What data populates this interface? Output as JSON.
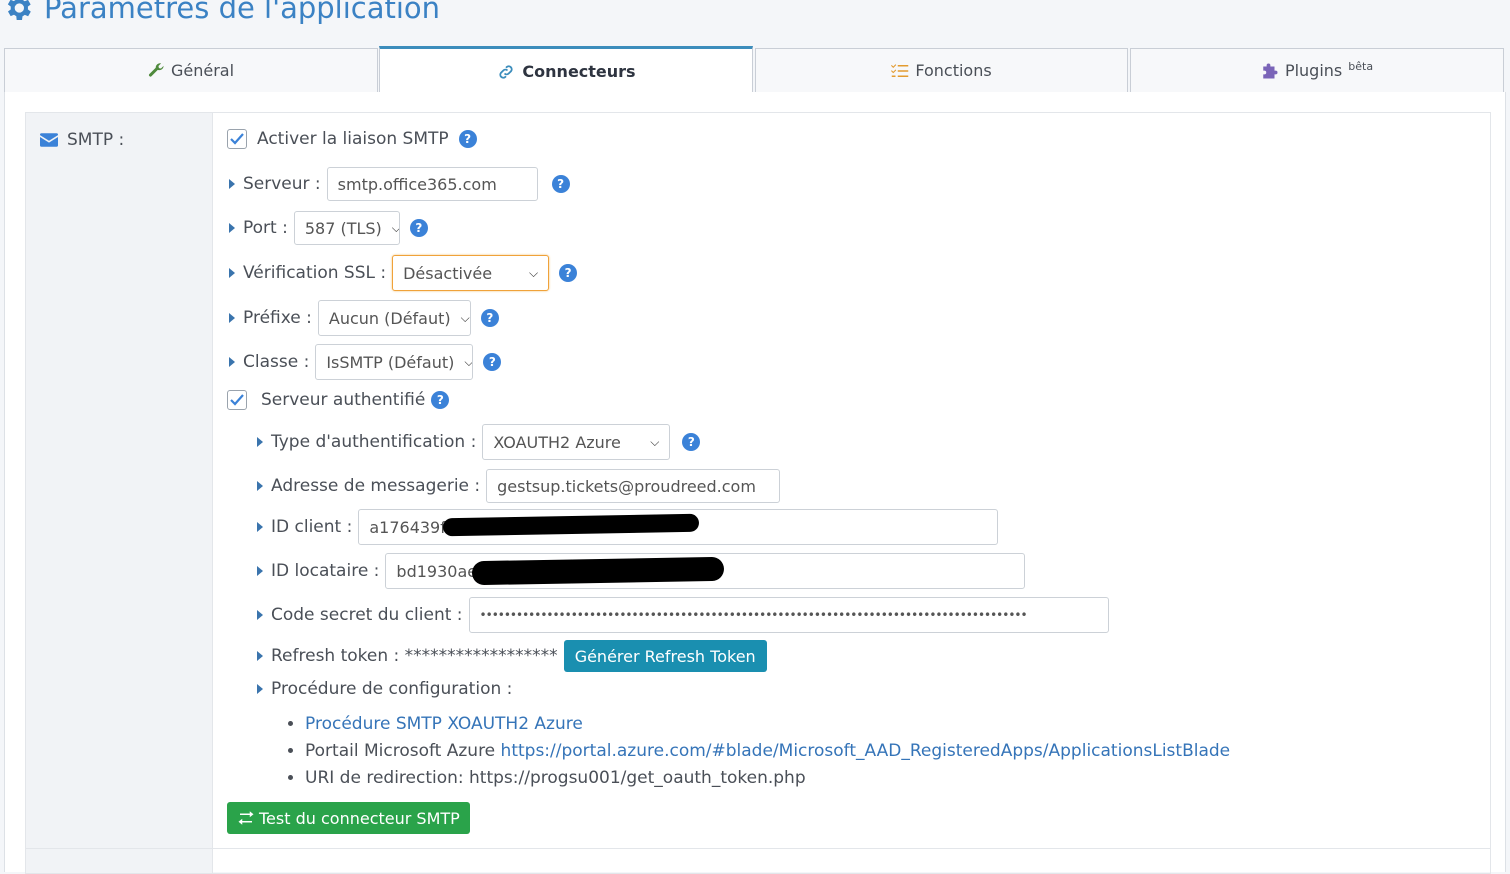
{
  "page": {
    "title": "Paramètres de l'application"
  },
  "tabs": [
    {
      "label": "Général",
      "icon": "wrench-icon",
      "icon_color": "#4f8a3c"
    },
    {
      "label": "Connecteurs",
      "icon": "link-icon",
      "icon_color": "#3c8dbc"
    },
    {
      "label": "Fonctions",
      "icon": "list-icon",
      "icon_color": "#e39b2f"
    },
    {
      "label": "Plugins",
      "sup": "bêta",
      "icon": "puzzle-icon",
      "icon_color": "#7a64b8"
    }
  ],
  "active_tab": "Connecteurs",
  "smtp": {
    "section_label": "SMTP :",
    "enable_label": "Activer la liaison SMTP",
    "enable_checked": true,
    "server_label": "Serveur :",
    "server_value": "smtp.office365.com",
    "port_label": "Port :",
    "port_value": "587 (TLS)",
    "ssl_label": "Vérification SSL :",
    "ssl_value": "Désactivée",
    "prefix_label": "Préfixe :",
    "prefix_value": "Aucun (Défaut)",
    "class_label": "Classe :",
    "class_value": "IsSMTP (Défaut)",
    "auth_label": "Serveur authentifié",
    "auth_checked": true,
    "auth_type_label": "Type d'authentification :",
    "auth_type_value": "XOAUTH2 Azure",
    "mail_label": "Adresse de messagerie :",
    "mail_value": "gestsup.tickets@proudreed.com",
    "client_id_label": "ID client :",
    "client_id_value": "a176439f",
    "tenant_label": "ID locataire :",
    "tenant_value": "bd1930ae",
    "secret_label": "Code secret du client :",
    "secret_value": "••••••••••••••••••••••••••••••••••••••••••••••••••••••••••••••••••••••••••••••••••••••••••",
    "refresh_label": "Refresh token : ******************",
    "refresh_button": "Générer Refresh Token",
    "procedure_label": "Procédure de configuration :",
    "procedure_link": "Procédure SMTP XOAUTH2 Azure",
    "portal_label": "Portail Microsoft Azure",
    "portal_link": "https://portal.azure.com/#blade/Microsoft_AAD_RegisteredApps/ApplicationsListBlade",
    "redirect_label": "URI de redirection: https://progsu001/get_oauth_token.php",
    "test_button": "Test du connecteur SMTP"
  },
  "colors": {
    "accent": "#3c8dbc",
    "title": "#3b82c4",
    "success": "#2aa34a",
    "info": "#1a8fb0",
    "help": "#3b82d8"
  }
}
